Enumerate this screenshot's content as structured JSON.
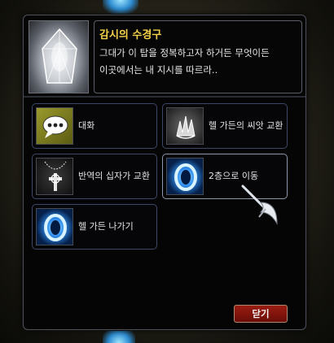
{
  "npc": {
    "name": "감시의 수경구",
    "dialog": "그대가 이 탑을 정복하고자 하거든 무엇이든\n이곳에서는 내 지시를 따르라.."
  },
  "options": [
    {
      "label": "대화",
      "icon": "chat-bubble-icon"
    },
    {
      "label": "헬 가든의 씨앗 교환",
      "icon": "seed-crystal-icon"
    },
    {
      "label": "반역의 십자가 교환",
      "icon": "cross-necklace-icon"
    },
    {
      "label": "2층으로 이동",
      "icon": "portal-ring-icon"
    },
    {
      "label": "헬 가든 나가기",
      "icon": "portal-ring-icon"
    }
  ],
  "close_label": "닫기",
  "colors": {
    "npc_name": "#f3d24a",
    "close_button": "#8a1710",
    "option_border": "#3c4866",
    "portal": "#2f8ff0"
  }
}
